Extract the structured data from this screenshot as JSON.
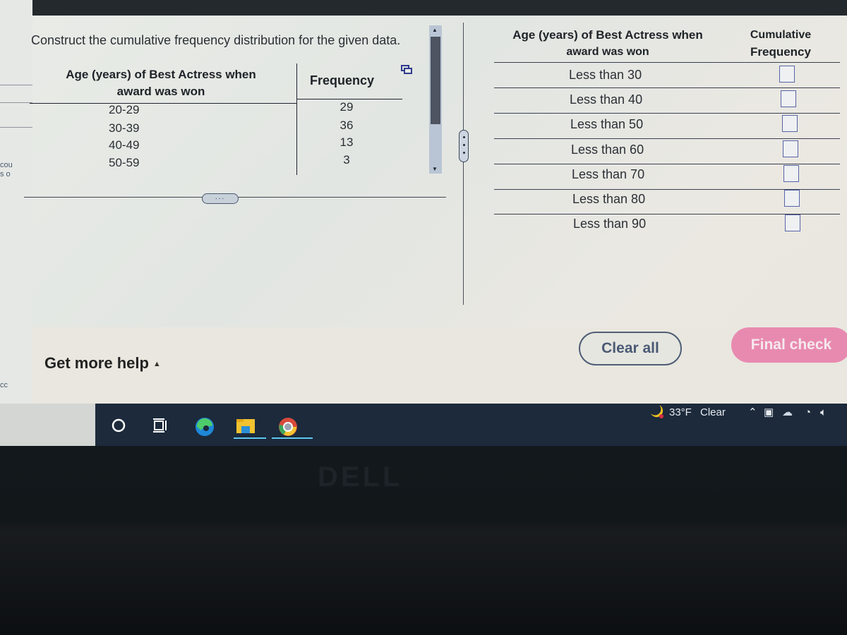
{
  "background_page": {
    "fragments": [
      "cou",
      "s o",
      "cc"
    ]
  },
  "question": {
    "prompt": "Construct the cumulative frequency distribution for the given data."
  },
  "given_table": {
    "headers": {
      "age_line1": "Age (years) of Best Actress when",
      "age_line2": "award was won",
      "frequency": "Frequency"
    },
    "rows": [
      {
        "age": "20-29",
        "frequency": "29"
      },
      {
        "age": "30-39",
        "frequency": "36"
      },
      {
        "age": "40-49",
        "frequency": "13"
      },
      {
        "age": "50-59",
        "frequency": "3"
      }
    ],
    "popout_icon": "popout-icon",
    "more_indicator": "..."
  },
  "answer_table": {
    "headers": {
      "age_line1": "Age (years) of Best Actress when",
      "age_line2": "award was won",
      "cf_line1": "Cumulative",
      "cf_line2": "Frequency"
    },
    "rows": [
      {
        "label": "Less than 30",
        "value": ""
      },
      {
        "label": "Less than 40",
        "value": ""
      },
      {
        "label": "Less than 50",
        "value": ""
      },
      {
        "label": "Less than 60",
        "value": ""
      },
      {
        "label": "Less than 70",
        "value": ""
      },
      {
        "label": "Less than 80",
        "value": ""
      },
      {
        "label": "Less than 90",
        "value": ""
      }
    ]
  },
  "footer": {
    "help_label": "Get more help",
    "clear_label": "Clear all",
    "final_label": "Final check"
  },
  "taskbar": {
    "apps": [
      "search",
      "task-view",
      "edge",
      "file-explorer",
      "chrome"
    ],
    "weather_temp": "33°F",
    "weather_desc": "Clear"
  },
  "colors": {
    "final_check": "#e88ab0",
    "clear_all_border": "#4f5e76",
    "input_border": "#5864a8",
    "taskbar": "#1c2a3c",
    "active_app_underline": "#5ec8f0"
  },
  "bezel": {
    "brand": "DELL"
  }
}
